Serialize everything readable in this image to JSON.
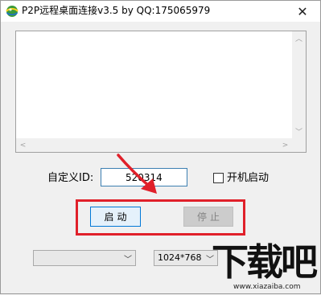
{
  "window": {
    "title": "P2P远程桌面连接v3.5 by QQ:175065979",
    "close_glyph": "✕",
    "icon": "app-globe-icon"
  },
  "log": {
    "text": ""
  },
  "form": {
    "id_label": "自定义ID:",
    "id_value": "520314",
    "autostart_label": "开机启动",
    "autostart_checked": false
  },
  "buttons": {
    "start_label": "启动",
    "stop_label": "停止"
  },
  "dropdowns": {
    "left_value": "",
    "resolution_value": "1024*768"
  },
  "watermark": {
    "main_text": "下载吧",
    "url_text": "www.xiazaiba.com"
  },
  "annotation": {
    "highlight_color": "#e0202a",
    "arrow_color": "#e0202a"
  },
  "colors": {
    "start_button_bg": "#e5f1fb",
    "start_button_border": "#0078d7",
    "stop_button_bg": "#cccccc"
  }
}
